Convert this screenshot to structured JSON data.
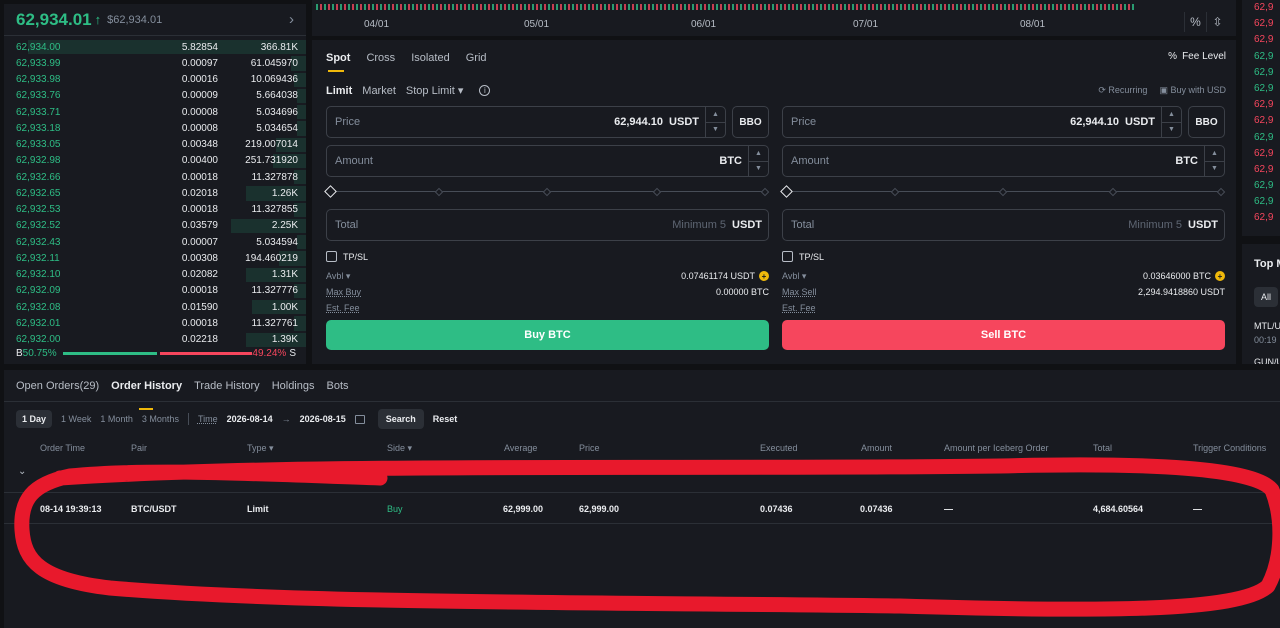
{
  "orderbook": {
    "last_price": "62,934.01",
    "mark_price": "$62,934.01",
    "rows": [
      {
        "price": "62,934.00",
        "qty": "5.82854",
        "total": "366.81K",
        "depth": 0.92
      },
      {
        "price": "62,933.99",
        "qty": "0.00097",
        "total": "61.045970",
        "depth": 0.05
      },
      {
        "price": "62,933.98",
        "qty": "0.00016",
        "total": "10.069436",
        "depth": 0.04
      },
      {
        "price": "62,933.76",
        "qty": "0.00009",
        "total": "5.664038",
        "depth": 0.03
      },
      {
        "price": "62,933.71",
        "qty": "0.00008",
        "total": "5.034696",
        "depth": 0.03
      },
      {
        "price": "62,933.18",
        "qty": "0.00008",
        "total": "5.034654",
        "depth": 0.03
      },
      {
        "price": "62,933.05",
        "qty": "0.00348",
        "total": "219.007014",
        "depth": 0.1
      },
      {
        "price": "62,932.98",
        "qty": "0.00400",
        "total": "251.731920",
        "depth": 0.11
      },
      {
        "price": "62,932.66",
        "qty": "0.00018",
        "total": "11.327878",
        "depth": 0.04
      },
      {
        "price": "62,932.65",
        "qty": "0.02018",
        "total": "1.26K",
        "depth": 0.2
      },
      {
        "price": "62,932.53",
        "qty": "0.00018",
        "total": "11.327855",
        "depth": 0.04
      },
      {
        "price": "62,932.52",
        "qty": "0.03579",
        "total": "2.25K",
        "depth": 0.25
      },
      {
        "price": "62,932.43",
        "qty": "0.00007",
        "total": "5.034594",
        "depth": 0.03
      },
      {
        "price": "62,932.11",
        "qty": "0.00308",
        "total": "194.460219",
        "depth": 0.09
      },
      {
        "price": "62,932.10",
        "qty": "0.02082",
        "total": "1.31K",
        "depth": 0.2
      },
      {
        "price": "62,932.09",
        "qty": "0.00018",
        "total": "11.327776",
        "depth": 0.04
      },
      {
        "price": "62,932.08",
        "qty": "0.01590",
        "total": "1.00K",
        "depth": 0.18
      },
      {
        "price": "62,932.01",
        "qty": "0.00018",
        "total": "11.327761",
        "depth": 0.04
      },
      {
        "price": "62,932.00",
        "qty": "0.02218",
        "total": "1.39K",
        "depth": 0.2
      }
    ],
    "buy_label": "B",
    "buy_pct": "50.75%",
    "sell_pct": "49.24%",
    "sell_label": "S"
  },
  "chart": {
    "dates": [
      "04/01",
      "05/01",
      "06/01",
      "07/01",
      "08/01"
    ],
    "tool_percent": "%",
    "tool_scale": "⇳"
  },
  "trade": {
    "mode_tabs": [
      "Spot",
      "Cross",
      "Isolated",
      "Grid"
    ],
    "fee_level": "Fee Level",
    "fee_icon": "%",
    "order_types": [
      "Limit",
      "Market",
      "Stop Limit"
    ],
    "info_icon": "i",
    "recurring": "Recurring",
    "buy_with_usd": "Buy with USD",
    "buy": {
      "price_label": "Price",
      "price_value": "62,944.10",
      "price_unit": "USDT",
      "bbo": "BBO",
      "amount_label": "Amount",
      "amount_unit": "BTC",
      "total_label": "Total",
      "total_min": "Minimum 5",
      "total_unit": "USDT",
      "tpsl": "TP/SL",
      "avbl_label": "Avbl",
      "avbl_value": "0.07461174 USDT",
      "max_label": "Max Buy",
      "max_value": "0.00000 BTC",
      "fee_label": "Est. Fee",
      "button": "Buy BTC"
    },
    "sell": {
      "price_label": "Price",
      "price_value": "62,944.10",
      "price_unit": "USDT",
      "bbo": "BBO",
      "amount_label": "Amount",
      "amount_unit": "BTC",
      "total_label": "Total",
      "total_min": "Minimum 5",
      "total_unit": "USDT",
      "tpsl": "TP/SL",
      "avbl_label": "Avbl",
      "avbl_value": "0.03646000 BTC",
      "max_label": "Max Sell",
      "max_value": "2,294.9418860 USDT",
      "fee_label": "Est. Fee",
      "button": "Sell BTC"
    }
  },
  "market": {
    "prices": [
      {
        "text": "62,9",
        "color": "#f6465d"
      },
      {
        "text": "62,9",
        "color": "#f6465d"
      },
      {
        "text": "62,9",
        "color": "#f6465d"
      },
      {
        "text": "62,9",
        "color": "#2ebd85"
      },
      {
        "text": "62,9",
        "color": "#2ebd85"
      },
      {
        "text": "62,9",
        "color": "#2ebd85"
      },
      {
        "text": "62,9",
        "color": "#f6465d"
      },
      {
        "text": "62,9",
        "color": "#f6465d"
      },
      {
        "text": "62,9",
        "color": "#2ebd85"
      },
      {
        "text": "62,9",
        "color": "#f6465d"
      },
      {
        "text": "62,9",
        "color": "#f6465d"
      },
      {
        "text": "62,9",
        "color": "#2ebd85"
      },
      {
        "text": "62,9",
        "color": "#2ebd85"
      },
      {
        "text": "62,9",
        "color": "#f6465d"
      }
    ],
    "top_movers_title": "Top M",
    "all_chip": "All",
    "mover_pair": "MTL/U",
    "mover_time": "00:19",
    "mover_pair2": "GUN/U"
  },
  "orders": {
    "tabs": [
      "Open Orders(29)",
      "Order History",
      "Trade History",
      "Holdings",
      "Bots"
    ],
    "ranges": [
      "1 Day",
      "1 Week",
      "1 Month",
      "3 Months"
    ],
    "time_label": "Time",
    "date_from": "2026-08-14",
    "date_arrow": "→",
    "date_to": "2026-08-15",
    "search": "Search",
    "reset": "Reset",
    "columns": [
      "Order Time",
      "Pair",
      "Type ▾",
      "Side ▾",
      "Average",
      "Price",
      "Executed",
      "Amount",
      "Amount per Iceberg Order",
      "Total",
      "Trigger Conditions"
    ],
    "collapse_icon": "⌄",
    "row": {
      "time": "08-14 19:39:13",
      "pair": "BTC/USDT",
      "type": "Limit",
      "side": "Buy",
      "average": "62,999.00",
      "price": "62,999.00",
      "executed": "0.07436",
      "amount": "0.07436",
      "iceberg": "—",
      "total": "4,684.60564",
      "trigger": "—"
    }
  }
}
